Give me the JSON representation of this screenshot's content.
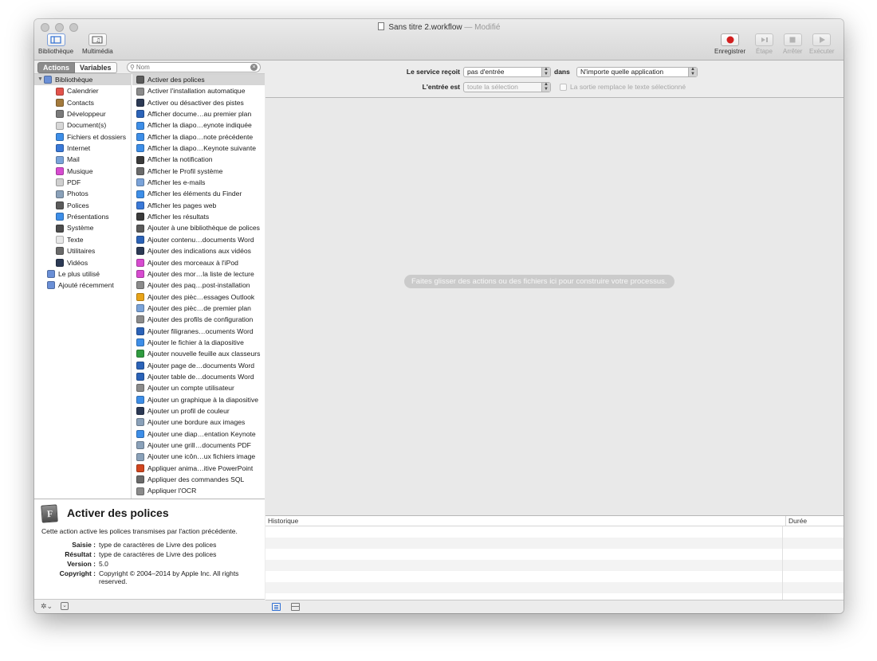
{
  "window": {
    "title": "Sans titre 2.workflow",
    "modified": "— Modifié"
  },
  "toolbar": {
    "library": "Bibliothèque",
    "media": "Multimédia",
    "record": "Enregistrer",
    "step": "Étape",
    "stop": "Arrêter",
    "run": "Exécuter"
  },
  "left": {
    "actions_tab": "Actions",
    "variables_tab": "Variables",
    "search_placeholder": "Nom"
  },
  "library": [
    {
      "label": "Bibliothèque",
      "icon": "library-icon",
      "color": "#6a8fd6"
    },
    {
      "label": "Calendrier",
      "icon": "calendar-icon",
      "color": "#e3534b"
    },
    {
      "label": "Contacts",
      "icon": "contacts-icon",
      "color": "#a37a3c"
    },
    {
      "label": "Développeur",
      "icon": "developer-icon",
      "color": "#7a7a7a"
    },
    {
      "label": "Document(s)",
      "icon": "document-icon",
      "color": "#d7d7d7"
    },
    {
      "label": "Fichiers et dossiers",
      "icon": "finder-icon",
      "color": "#3d8ee8"
    },
    {
      "label": "Internet",
      "icon": "internet-icon",
      "color": "#3a79d8"
    },
    {
      "label": "Mail",
      "icon": "mail-icon",
      "color": "#7aa3d9"
    },
    {
      "label": "Musique",
      "icon": "music-icon",
      "color": "#d74bd0"
    },
    {
      "label": "PDF",
      "icon": "pdf-icon",
      "color": "#cfcfcf"
    },
    {
      "label": "Photos",
      "icon": "photos-icon",
      "color": "#8aa1b9"
    },
    {
      "label": "Polices",
      "icon": "fonts-icon",
      "color": "#5b5b5b"
    },
    {
      "label": "Présentations",
      "icon": "keynote-icon",
      "color": "#3d8ee8"
    },
    {
      "label": "Système",
      "icon": "system-icon",
      "color": "#4d4d4d"
    },
    {
      "label": "Texte",
      "icon": "text-icon",
      "color": "#e8e8e8"
    },
    {
      "label": "Utilitaires",
      "icon": "utilities-icon",
      "color": "#6a6a6a"
    },
    {
      "label": "Vidéos",
      "icon": "video-icon",
      "color": "#2c3a55"
    },
    {
      "label": "Le plus utilisé",
      "icon": "most-used-icon",
      "color": "#6a8fd6"
    },
    {
      "label": "Ajouté récemment",
      "icon": "recent-icon",
      "color": "#6a8fd6"
    }
  ],
  "actions": [
    {
      "label": "Activer des polices",
      "icon": "fonts-icon",
      "color": "#5b5b5b"
    },
    {
      "label": "Activer l'installation automatique",
      "icon": "installer-icon",
      "color": "#8b8b8b"
    },
    {
      "label": "Activer ou désactiver des pistes",
      "icon": "quicktime-icon",
      "color": "#2c3a55"
    },
    {
      "label": "Afficher docume…au premier plan",
      "icon": "word-icon",
      "color": "#2b63b8"
    },
    {
      "label": "Afficher la diapo…eynote indiquée",
      "icon": "keynote-icon",
      "color": "#3d8ee8"
    },
    {
      "label": "Afficher la diapo…note précédente",
      "icon": "keynote-icon",
      "color": "#3d8ee8"
    },
    {
      "label": "Afficher la diapo…Keynote suivante",
      "icon": "keynote-icon",
      "color": "#3d8ee8"
    },
    {
      "label": "Afficher la notification",
      "icon": "automator-icon",
      "color": "#3a3a3a"
    },
    {
      "label": "Afficher le Profil système",
      "icon": "tools-icon",
      "color": "#6a6a6a"
    },
    {
      "label": "Afficher les e-mails",
      "icon": "mail-icon",
      "color": "#7aa3d9"
    },
    {
      "label": "Afficher les éléments du Finder",
      "icon": "finder-icon",
      "color": "#3d8ee8"
    },
    {
      "label": "Afficher les pages web",
      "icon": "safari-icon",
      "color": "#3a79d8"
    },
    {
      "label": "Afficher les résultats",
      "icon": "automator-icon",
      "color": "#3a3a3a"
    },
    {
      "label": "Ajouter à une bibliothèque de polices",
      "icon": "fonts-icon",
      "color": "#5b5b5b"
    },
    {
      "label": "Ajouter contenu…documents Word",
      "icon": "word-icon",
      "color": "#2b63b8"
    },
    {
      "label": "Ajouter des indications aux vidéos",
      "icon": "quicktime-icon",
      "color": "#2c3a55"
    },
    {
      "label": "Ajouter des morceaux à l'iPod",
      "icon": "music-icon",
      "color": "#d74bd0"
    },
    {
      "label": "Ajouter des mor…la liste de lecture",
      "icon": "music-icon",
      "color": "#d74bd0"
    },
    {
      "label": "Ajouter des paq…post-installation",
      "icon": "installer-icon",
      "color": "#8b8b8b"
    },
    {
      "label": "Ajouter des pièc…essages Outlook",
      "icon": "outlook-icon",
      "color": "#e8a318"
    },
    {
      "label": "Ajouter des pièc…de premier plan",
      "icon": "mail-icon",
      "color": "#7aa3d9"
    },
    {
      "label": "Ajouter des profils de configuration",
      "icon": "installer-icon",
      "color": "#8b8b8b"
    },
    {
      "label": "Ajouter filigranes…ocuments Word",
      "icon": "word-icon",
      "color": "#2b63b8"
    },
    {
      "label": "Ajouter le fichier à la diapositive",
      "icon": "keynote-icon",
      "color": "#3d8ee8"
    },
    {
      "label": "Ajouter nouvelle feuille aux classeurs",
      "icon": "excel-icon",
      "color": "#2f9b3f"
    },
    {
      "label": "Ajouter page de…documents Word",
      "icon": "word-icon",
      "color": "#2b63b8"
    },
    {
      "label": "Ajouter table de…documents Word",
      "icon": "word-icon",
      "color": "#2b63b8"
    },
    {
      "label": "Ajouter un compte utilisateur",
      "icon": "installer-icon",
      "color": "#8b8b8b"
    },
    {
      "label": "Ajouter un graphique à la diapositive",
      "icon": "keynote-icon",
      "color": "#3d8ee8"
    },
    {
      "label": "Ajouter un profil de couleur",
      "icon": "colorsync-icon",
      "color": "#2c3a55"
    },
    {
      "label": "Ajouter une bordure aux images",
      "icon": "preview-icon",
      "color": "#8aa1b9"
    },
    {
      "label": "Ajouter une diap…entation Keynote",
      "icon": "keynote-icon",
      "color": "#3d8ee8"
    },
    {
      "label": "Ajouter une grill…documents PDF",
      "icon": "preview-icon",
      "color": "#8aa1b9"
    },
    {
      "label": "Ajouter une icôn…ux fichiers image",
      "icon": "preview-icon",
      "color": "#8aa1b9"
    },
    {
      "label": "Appliquer anima…itive PowerPoint",
      "icon": "powerpoint-icon",
      "color": "#d2461f"
    },
    {
      "label": "Appliquer des commandes SQL",
      "icon": "tools-icon",
      "color": "#6a6a6a"
    },
    {
      "label": "Appliquer l'OCR",
      "icon": "installer-icon",
      "color": "#8b8b8b"
    }
  ],
  "description": {
    "title": "Activer des polices",
    "sentence": "Cette action active les polices transmises par l'action précédente.",
    "rows": [
      {
        "k": "Saisie :",
        "v": "type de caractères de Livre des polices"
      },
      {
        "k": "Résultat :",
        "v": "type de caractères de Livre des polices"
      },
      {
        "k": "Version :",
        "v": "5.0"
      },
      {
        "k": "Copyright :",
        "v": "Copyright © 2004–2014 by Apple Inc. All rights reserved."
      }
    ]
  },
  "service": {
    "receives_label": "Le service reçoit",
    "receives_value": "pas d'entrée",
    "in_label": "dans",
    "in_value": "N'importe quelle application",
    "input_label": "L'entrée est",
    "input_value": "toute la sélection",
    "replace_label": "La sortie remplace le texte sélectionné"
  },
  "workflow": {
    "hint": "Faites glisser des actions ou des fichiers ici pour construire votre processus."
  },
  "history": {
    "col1": "Historique",
    "col2": "Durée"
  }
}
